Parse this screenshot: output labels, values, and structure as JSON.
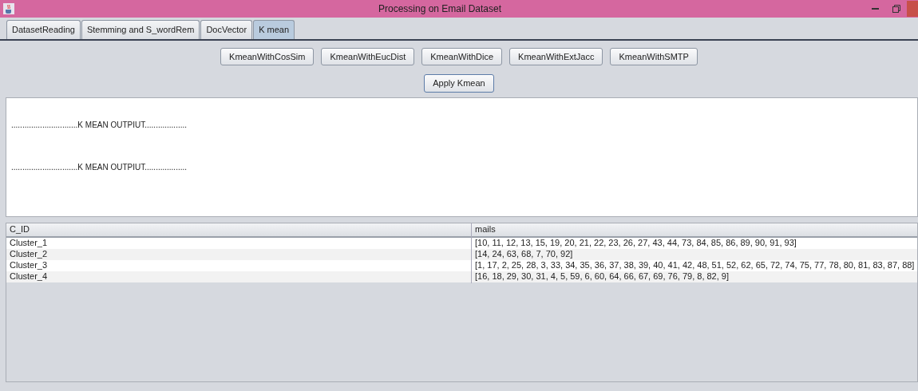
{
  "window": {
    "title": "Processing on Email Dataset"
  },
  "tabs": [
    {
      "label": "DatasetReading",
      "selected": false
    },
    {
      "label": "Stemming and S_wordRem",
      "selected": false
    },
    {
      "label": "DocVector",
      "selected": false
    },
    {
      "label": "K mean",
      "selected": true
    }
  ],
  "method_buttons": [
    "KmeanWithCosSim",
    "KmeanWithEucDist",
    "KmeanWithDice",
    "KmeanWithExtJacc",
    "KmeanWithSMTP"
  ],
  "apply_button": "Apply Kmean",
  "output_lines": [
    "..............................K MEAN OUTPIUT...................",
    "..............................K MEAN OUTPIUT..................."
  ],
  "table": {
    "columns": [
      "C_ID",
      "mails"
    ],
    "rows": [
      [
        "Cluster_1",
        "[10, 11, 12, 13, 15, 19, 20, 21, 22, 23, 26, 27, 43, 44, 73, 84, 85, 86, 89, 90, 91, 93]"
      ],
      [
        "Cluster_2",
        "[14, 24, 63, 68, 7, 70, 92]"
      ],
      [
        "Cluster_3",
        "[1, 17, 2, 25, 28, 3, 33, 34, 35, 36, 37, 38, 39, 40, 41, 42, 48, 51, 52, 62, 65, 72, 74, 75, 77, 78, 80, 81, 83, 87, 88]"
      ],
      [
        "Cluster_4",
        "[16, 18, 29, 30, 31, 4, 5, 59, 6, 60, 64, 66, 67, 69, 76, 79, 8, 82, 9]"
      ]
    ]
  }
}
